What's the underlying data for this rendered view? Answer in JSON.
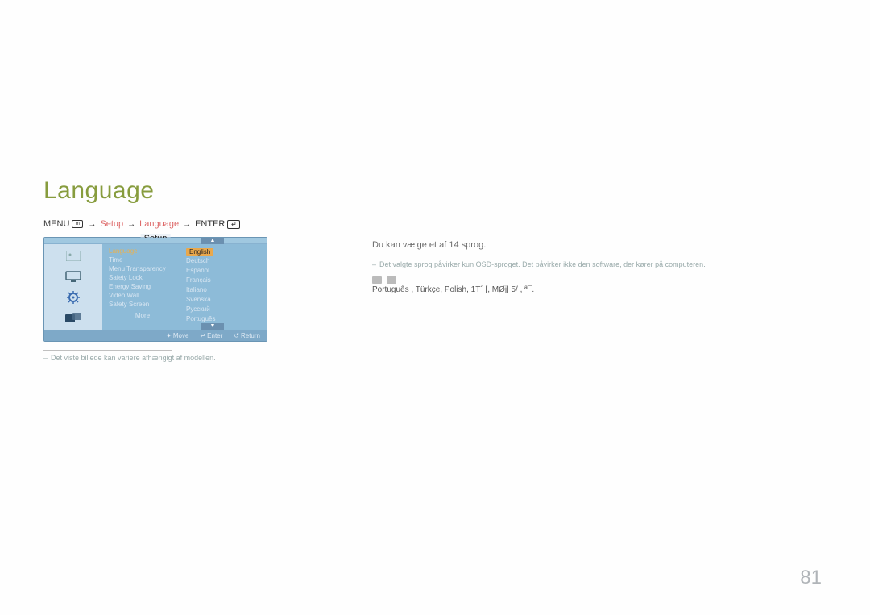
{
  "sectionTitle": "Language",
  "path": {
    "menu": "MENU",
    "menuGlyph": "m",
    "step1": "Setup",
    "step2": "Language",
    "enter": "ENTER"
  },
  "osd": {
    "title": "Setup",
    "sidebarIcons": [
      "picture-icon",
      "display-icon",
      "gear-icon",
      "tools-icon"
    ],
    "left": [
      {
        "label": "Language",
        "hl": true
      },
      {
        "label": "Time",
        "hl": false
      },
      {
        "label": "Menu Transparency",
        "hl": false
      },
      {
        "label": "Safety Lock",
        "hl": false
      },
      {
        "label": "Energy Saving",
        "hl": false
      },
      {
        "label": "Video Wall",
        "hl": false
      },
      {
        "label": "Safety Screen",
        "hl": false
      }
    ],
    "more": "More",
    "right": [
      {
        "label": "English",
        "sel": true
      },
      {
        "label": "Deutsch",
        "sel": false
      },
      {
        "label": "Español",
        "sel": false
      },
      {
        "label": "Français",
        "sel": false
      },
      {
        "label": "Italiano",
        "sel": false
      },
      {
        "label": "Svenska",
        "sel": false
      },
      {
        "label": "Русский",
        "sel": false
      },
      {
        "label": "Português",
        "sel": false
      }
    ],
    "bottom": {
      "move": "Move",
      "enter": "Enter",
      "return": "Return"
    }
  },
  "footnote": "Det viste billede kan variere afhængigt af modellen.",
  "right": {
    "intro": "Du kan vælge et af 14 sprog.",
    "bullet": "Det valgte sprog påvirker kun OSD-sproget. Det påvirker ikke den software, der kører på computeren.",
    "langLine1Prefix": "",
    "langLine2": "Português , Türkçe, Polish, 1Т´ [,  МØj| 5/ ,     ª¯."
  },
  "pageNumber": "81"
}
